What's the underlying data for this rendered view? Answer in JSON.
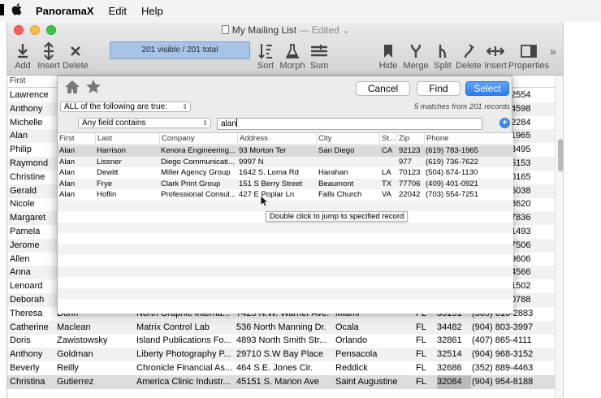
{
  "menubar": {
    "apple": "",
    "app_name": "PanoramaX",
    "items": [
      "Edit",
      "Help"
    ]
  },
  "window": {
    "title": "My Mailing List",
    "status": "— Edited",
    "status_arrow": "⌄"
  },
  "toolbar": {
    "buttons": [
      {
        "label": "Add",
        "icon": "add-icon"
      },
      {
        "label": "Insert",
        "icon": "insert-icon"
      },
      {
        "label": "Delete",
        "icon": "delete-x-icon"
      },
      {
        "label": "Sort",
        "icon": "sort-icon"
      },
      {
        "label": "Morph",
        "icon": "flask-icon"
      },
      {
        "label": "Sum",
        "icon": "sum-icon"
      },
      {
        "label": "Hide",
        "icon": "bookmark-icon"
      },
      {
        "label": "Merge",
        "icon": "merge-icon"
      },
      {
        "label": "Split",
        "icon": "split-icon"
      },
      {
        "label": "Delete",
        "icon": "delete-field-icon"
      },
      {
        "label": "Insert",
        "icon": "insert-field-icon"
      },
      {
        "label": "Properties",
        "icon": "sidebar-icon"
      }
    ],
    "summary": "201 visible / 201 total",
    "overflow": "»"
  },
  "list": {
    "header_first": "First",
    "rows": [
      {
        "first": "Lawrence",
        "phone_tail": "2554"
      },
      {
        "first": "Anthony",
        "phone_tail": "4598"
      },
      {
        "first": "Michelle",
        "phone_tail": "2284"
      },
      {
        "first": "Alan",
        "phone_tail": "1965"
      },
      {
        "first": "Philip",
        "phone_tail": "8495"
      },
      {
        "first": "Raymond",
        "phone_tail": "5153"
      },
      {
        "first": "Christine",
        "phone_tail": "0165"
      },
      {
        "first": "Gerald",
        "phone_tail": "5038"
      },
      {
        "first": "Nicole",
        "phone_tail": "8620"
      },
      {
        "first": "Margaret",
        "phone_tail": "7836"
      },
      {
        "first": "Pamela",
        "phone_tail": "1493"
      },
      {
        "first": "Jerome",
        "phone_tail": "7506"
      },
      {
        "first": "Allen",
        "phone_tail": "9606"
      },
      {
        "first": "Anna",
        "phone_tail": "4566"
      },
      {
        "first": "Lenoard",
        "phone_tail": "1502"
      },
      {
        "first": "Deborah",
        "phone_tail": "0788"
      }
    ],
    "full_rows": [
      {
        "first": "Theresa",
        "last": "Dunn",
        "company": "North Graphic Interna...",
        "address": "7425 N.W. Warner Ave.",
        "city": "Miami",
        "state": "FL",
        "zip": "33151",
        "phone": "(305) 616-2883"
      },
      {
        "first": "Catherine",
        "last": "Maclean",
        "company": "Matrix Control Lab",
        "address": "536 North Manning Dr.",
        "city": "Ocala",
        "state": "FL",
        "zip": "34482",
        "phone": "(904) 803-3997"
      },
      {
        "first": "Doris",
        "last": "Zawistowsky",
        "company": "Island Publications Fo...",
        "address": "4893 North Smith Str...",
        "city": "Orlando",
        "state": "FL",
        "zip": "32861",
        "phone": "(407) 865-4111"
      },
      {
        "first": "Anthony",
        "last": "Goldman",
        "company": "Liberty Photography P...",
        "address": "29710 S.W Bay Place",
        "city": "Pensacola",
        "state": "FL",
        "zip": "32514",
        "phone": "(904) 968-3152"
      },
      {
        "first": "Beverly",
        "last": "Reilly",
        "company": "Chronicle Financial As...",
        "address": "464 S.E. Jones Cir.",
        "city": "Reddick",
        "state": "FL",
        "zip": "32686",
        "phone": "(352) 889-4463"
      },
      {
        "first": "Christina",
        "last": "Gutierrez",
        "company": "America Clinic Industr...",
        "address": "45151 S. Marion Ave",
        "city": "Saint Augustine",
        "state": "FL",
        "zip": "32084",
        "phone": "(904) 954-8188"
      }
    ]
  },
  "find": {
    "cancel": "Cancel",
    "find": "Find",
    "select": "Select",
    "match_mode": "ALL of the following are true:",
    "match_info": "5 matches from 201 records",
    "field_mode": "Any field contains",
    "search_value": "alan",
    "add_symbol": "+",
    "columns": [
      "First",
      "Last",
      "Company",
      "Address",
      "City",
      "St...",
      "Zip",
      "Phone"
    ],
    "results": [
      {
        "first": "Alan",
        "last": "Harrison",
        "company": "Kenora Engineering...",
        "address": "93 Morton Ter",
        "city": "San Diego",
        "state": "CA",
        "zip": "92123",
        "phone": "(619) 783-1965"
      },
      {
        "first": "Alan",
        "last": "Lissner",
        "company": "Diego Communicati...",
        "address": "9997 N",
        "city": "",
        "state": "",
        "zip": "977",
        "phone": "(619) 736-7622"
      },
      {
        "first": "Alan",
        "last": "Dewitt",
        "company": "Miller Agency Group",
        "address": "1642 S. Loma Rd",
        "city": "Harahan",
        "state": "LA",
        "zip": "70123",
        "phone": "(504) 674-1130"
      },
      {
        "first": "Alan",
        "last": "Frye",
        "company": "Clark Print Group",
        "address": "151 S Berry Street",
        "city": "Beaumont",
        "state": "TX",
        "zip": "77706",
        "phone": "(409) 401-0921"
      },
      {
        "first": "Alan",
        "last": "Hoflin",
        "company": "Professional Consul...",
        "address": "427 E Poplar Ln",
        "city": "Falls Church",
        "state": "VA",
        "zip": "22042",
        "phone": "(703) 554-7251"
      }
    ],
    "tooltip": "Double click to jump to specified record"
  }
}
